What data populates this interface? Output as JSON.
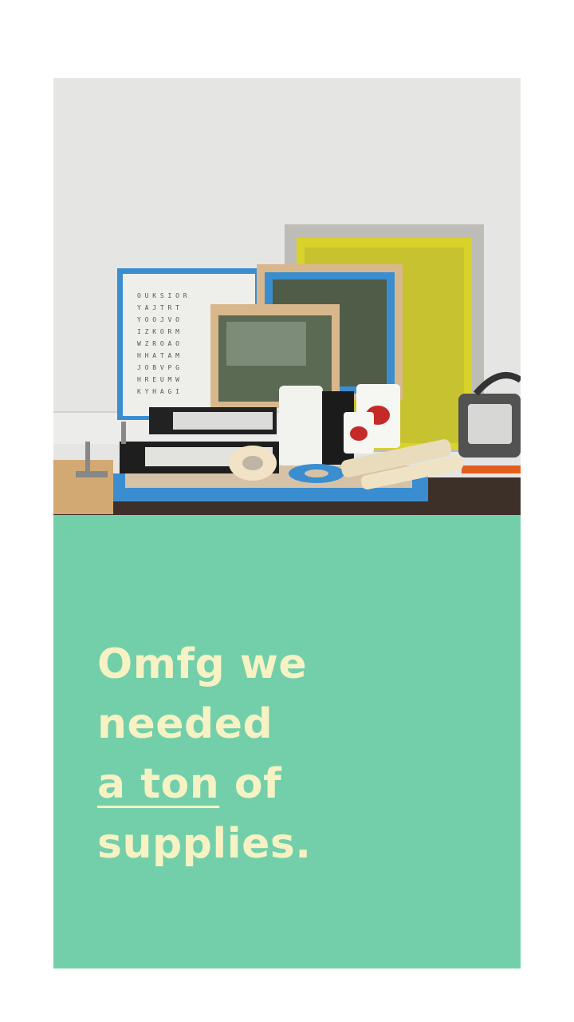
{
  "photo": {
    "alt_subject": "screen printing supplies",
    "colors": {
      "wall": "#e4e4e3",
      "floor": "#3d3029",
      "tape_blue": "#3a8ed0",
      "frame_wood": "#d9b78d",
      "yellow_screen": "#d8d12a",
      "mesh_dark": "#5b6a52"
    }
  },
  "panel": {
    "background": "#73cfaa",
    "text_color": "#f7f2c4",
    "headline": {
      "line1": "Omfg we",
      "line2": "needed",
      "line3_underlined": "a ton",
      "line3_rest": " of",
      "line4": "supplies."
    }
  }
}
